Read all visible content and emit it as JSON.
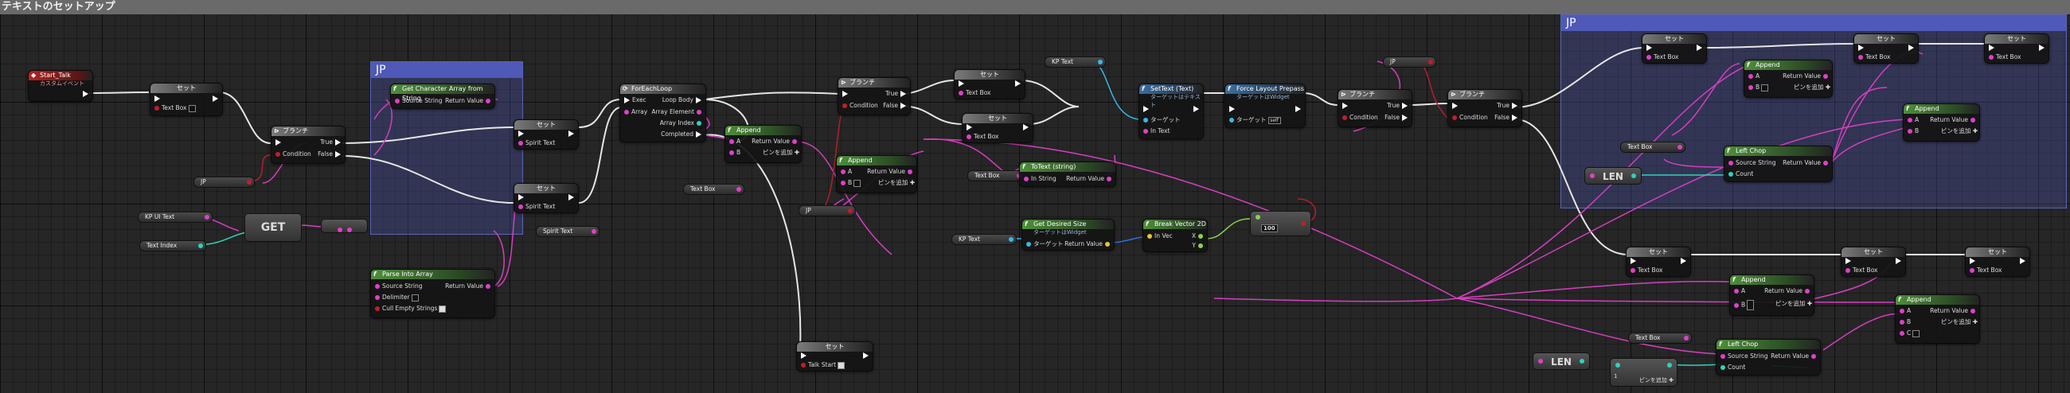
{
  "window": {
    "title": "テキストのセットアップ"
  },
  "comments": [
    {
      "title": "JP"
    },
    {
      "title": "JP"
    }
  ],
  "labels": {
    "set": "セット",
    "branch": "ブランチ",
    "true": "True",
    "false": "False",
    "condition": "Condition",
    "text_box": "Text Box",
    "spirit_text": "Spirit Text",
    "kp_text": "KP Text",
    "kp_ui_text": "KP UI Text",
    "text_index": "Text Index",
    "jp": "JP",
    "return_value": "Return Value",
    "a": "A",
    "b": "B",
    "c": "C",
    "add_pin": "ピンを追加",
    "target": "ターゲット",
    "talk_start": "Talk Start",
    "get": "GET",
    "len": "LEN",
    "equals": "==",
    "compact_value": "100",
    "one": "1",
    "x": "X",
    "y": "Y",
    "count": "Count",
    "source_string": "Source String",
    "in_text": "In Text",
    "in_vec": "In Vec",
    "in_string": "In String"
  },
  "nodes": {
    "start_talk": {
      "title": "Start_Talk",
      "sub": "カスタムイベント"
    },
    "get_char_array": {
      "title": "Get Character Array from String"
    },
    "parse_into_array": {
      "title": "Parse Into Array",
      "delimiter": "Delimiter",
      "cull": "Cull Empty Strings"
    },
    "for_each": {
      "title": "ForEachLoop",
      "exec": "Exec",
      "array": "Array",
      "loop_body": "Loop Body",
      "array_element": "Array Element",
      "array_index": "Array Index",
      "completed": "Completed"
    },
    "append": {
      "title": "Append"
    },
    "to_text": {
      "title": "ToText (string)"
    },
    "set_text": {
      "title": "SetText (Text)",
      "sub": "ターゲットはテキスト"
    },
    "force_layout": {
      "title": "Force Layout Prepass",
      "sub": "ターゲットはWidget",
      "value": "self"
    },
    "desired_size": {
      "title": "Get Desired Size",
      "sub": "ターゲットはWidget"
    },
    "break_vector": {
      "title": "Break Vector 2D"
    },
    "left_chop": {
      "title": "Left Chop"
    }
  }
}
